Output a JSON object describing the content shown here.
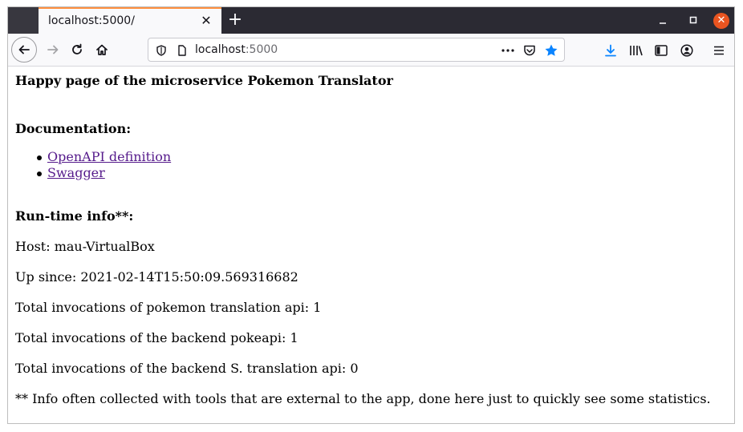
{
  "browser": {
    "tab_title": "localhost:5000/",
    "url_host": "localhost",
    "url_port": ":5000"
  },
  "page": {
    "heading": "Happy page of the microservice Pokemon Translator",
    "documentation_heading": "Documentation:",
    "links": [
      "OpenAPI definition",
      "Swagger"
    ],
    "runtime_heading": "Run-time info**:",
    "host_line": "Host: mau-VirtualBox",
    "up_since_line": "Up since: 2021-02-14T15:50:09.569316682",
    "invocations_translation": "Total invocations of pokemon translation api: 1",
    "invocations_pokeapi": "Total invocations of the backend pokeapi: 1",
    "invocations_s_translation": "Total invocations of the backend S. translation api: 0",
    "footnote": "** Info often collected with tools that are external to the app, done here just to quickly see some statistics."
  },
  "colors": {
    "accent_tab": "#ff8f3e",
    "close_button": "#e95420",
    "bookmark_star": "#0a84ff",
    "download_arrow": "#0a84ff",
    "visited_link": "#551a8b"
  }
}
